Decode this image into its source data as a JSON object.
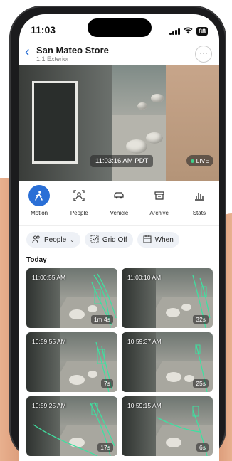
{
  "status_bar": {
    "time": "11:03",
    "battery": "88"
  },
  "header": {
    "title": "San Mateo Store",
    "subtitle": "1.1 Exterior"
  },
  "feed": {
    "timestamp": "11:03:16 AM PDT",
    "live_label": "LIVE"
  },
  "tools": [
    {
      "label": "Motion",
      "icon": "motion-icon",
      "active": true
    },
    {
      "label": "People",
      "icon": "person-scan-icon",
      "active": false
    },
    {
      "label": "Vehicle",
      "icon": "vehicle-icon",
      "active": false
    },
    {
      "label": "Archive",
      "icon": "archive-icon",
      "active": false
    },
    {
      "label": "Stats",
      "icon": "bar-chart-icon",
      "active": false
    }
  ],
  "filters": {
    "people": "People",
    "grid": "Grid Off",
    "when": "When"
  },
  "section_title": "Today",
  "clips": [
    {
      "time": "11:00:55 AM",
      "duration": "1m 4s"
    },
    {
      "time": "11:00:10 AM",
      "duration": "32s"
    },
    {
      "time": "10:59:55 AM",
      "duration": "7s"
    },
    {
      "time": "10:59:37 AM",
      "duration": "25s"
    },
    {
      "time": "10:59:25 AM",
      "duration": "17s"
    },
    {
      "time": "10:59:15 AM",
      "duration": "6s"
    }
  ],
  "colors": {
    "accent": "#2a6fd6",
    "track": "#3fe0a0",
    "live_dot": "#3fd08a"
  }
}
